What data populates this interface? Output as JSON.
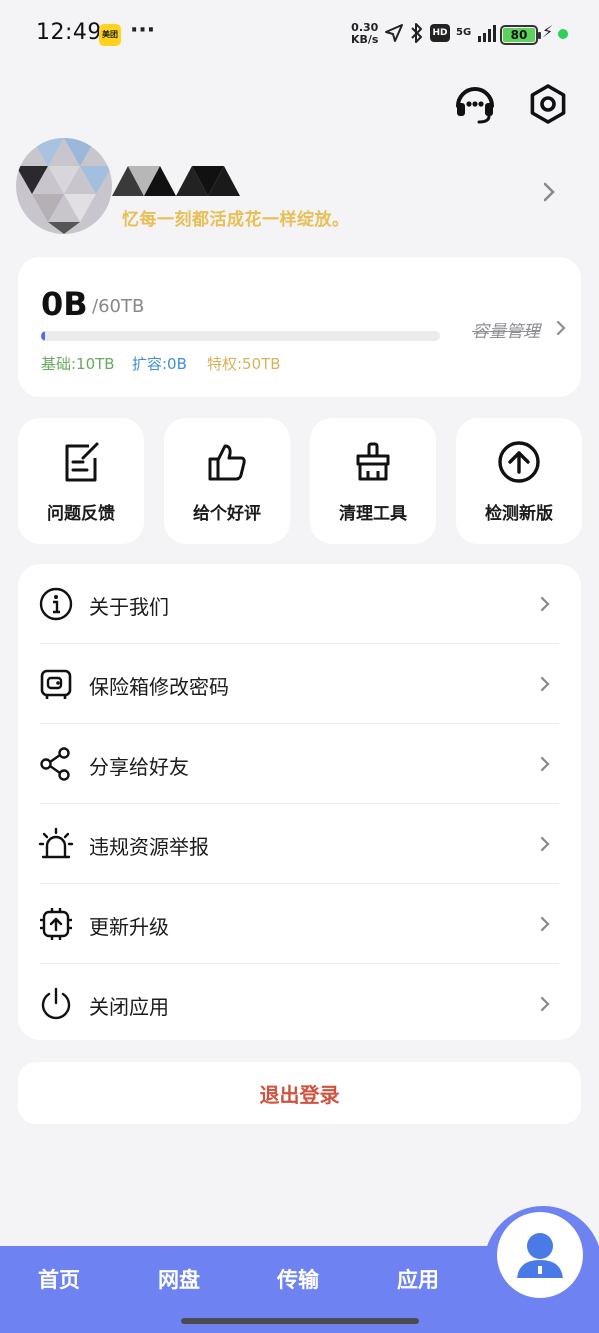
{
  "status_bar": {
    "time": "12:49",
    "app_badge": "美团",
    "dots": "···",
    "speed_top": "0.30",
    "speed_bottom": "KB/s",
    "hd": "HD",
    "net": "5G",
    "battery": "80"
  },
  "header": {
    "support_icon": "headset-icon",
    "settings_icon": "settings-hex-icon"
  },
  "profile": {
    "motto": "忆每一刻都活成花一样绽放。"
  },
  "storage": {
    "used": "0B",
    "total": "/60TB",
    "used_fraction": 0.01,
    "manage_label": "容量管理",
    "quota_base": "基础:10TB",
    "quota_expand": "扩容:0B",
    "quota_privilege": "特权:50TB",
    "colors": {
      "bar": "#4a6cf0",
      "base": "#6aa863",
      "expand": "#3e8fd7",
      "privilege": "#d5b35c"
    }
  },
  "quick_actions": [
    {
      "label": "问题反馈",
      "icon": "feedback-edit-icon"
    },
    {
      "label": "给个好评",
      "icon": "thumbs-up-icon"
    },
    {
      "label": "清理工具",
      "icon": "broom-icon"
    },
    {
      "label": "检测新版",
      "icon": "upload-arrow-icon"
    }
  ],
  "menu": [
    {
      "label": "关于我们",
      "icon": "info-icon"
    },
    {
      "label": "保险箱修改密码",
      "icon": "safe-icon"
    },
    {
      "label": "分享给好友",
      "icon": "share-icon"
    },
    {
      "label": "违规资源举报",
      "icon": "alarm-icon"
    },
    {
      "label": "更新升级",
      "icon": "chip-upgrade-icon"
    },
    {
      "label": "关闭应用",
      "icon": "power-icon"
    }
  ],
  "logout": {
    "label": "退出登录",
    "color": "#d0533f"
  },
  "bottom_nav": {
    "items": [
      {
        "label": "首页"
      },
      {
        "label": "网盘"
      },
      {
        "label": "传输"
      },
      {
        "label": "应用"
      }
    ],
    "active_icon": "user-icon",
    "color": "#6e82f2"
  }
}
